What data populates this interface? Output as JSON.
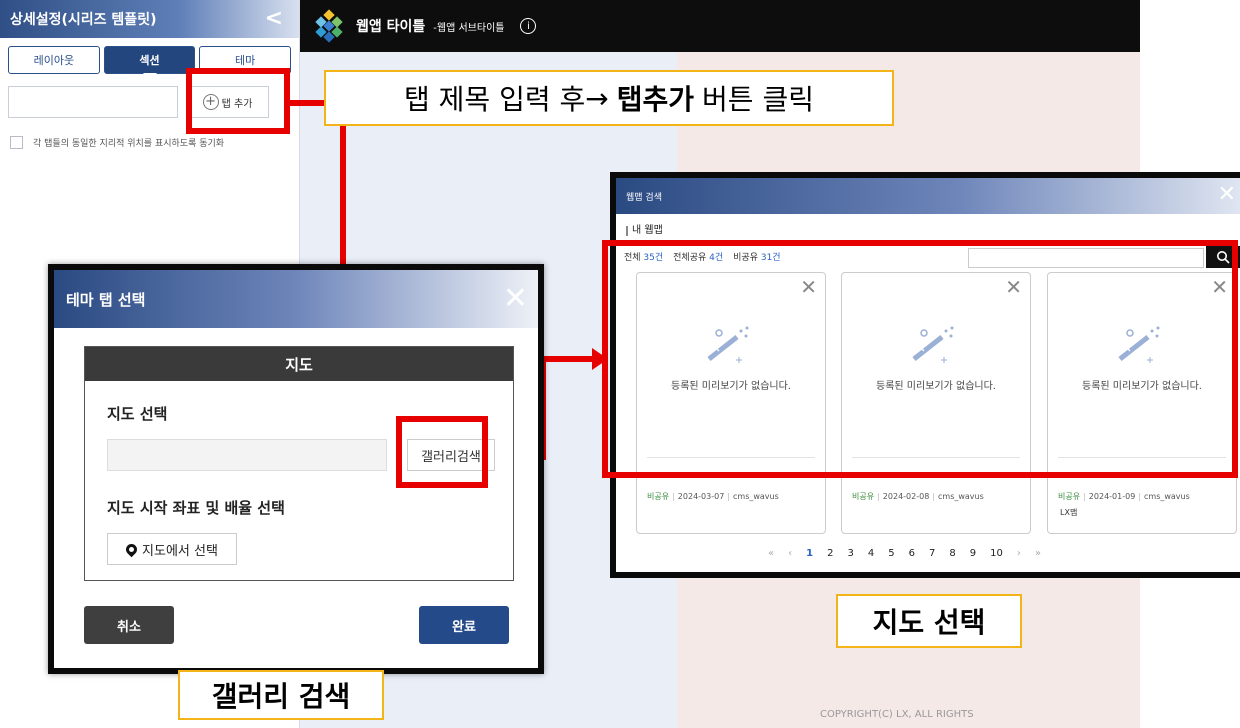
{
  "left_panel": {
    "title": "상세설정(시리즈 템플릿)",
    "collapse_icon": "<",
    "tabs": [
      {
        "label": "레이아웃"
      },
      {
        "label": "섹션"
      },
      {
        "label": "테마"
      }
    ],
    "add_tab_label": "탭 추가",
    "sync_label": "각 탭들의 동일한 지리적 위치를 표시하도록 동기화"
  },
  "header": {
    "app_title": "웹앱 타이틀",
    "app_subtitle": "-웹앱 서브타이틀",
    "info_icon": "i"
  },
  "callouts": {
    "top": {
      "pre": "탭 제목 입력 후 ",
      "arrow": "→",
      "bold": "탭추가",
      "post": "버튼 클릭"
    },
    "map_select": "지도 선택",
    "gallery_search": "갤러리 검색"
  },
  "theme_dialog": {
    "title": "테마 탭 선택",
    "section_title": "지도",
    "map_select_label": "지도 선택",
    "gallery_search_button": "갤러리검색",
    "coord_label": "지도 시작 좌표 및 배율 선택",
    "select_on_map_button": "지도에서 선택",
    "cancel": "취소",
    "done": "완료"
  },
  "webmap_dialog": {
    "title": "웹맵 검색",
    "section": "내 웹맵",
    "counts": [
      {
        "label": "전체 ",
        "value": "35건"
      },
      {
        "label": "전체공유 ",
        "value": "4건"
      },
      {
        "label": "비공유 ",
        "value": "31건"
      }
    ],
    "cards": [
      {
        "no_preview": "등록된 미리보기가 없습니다.",
        "share": "비공유",
        "date": "2024-03-07",
        "owner": "cms_wavus",
        "name": ""
      },
      {
        "no_preview": "등록된 미리보기가 없습니다.",
        "share": "비공유",
        "date": "2024-02-08",
        "owner": "cms_wavus",
        "name": ""
      },
      {
        "no_preview": "등록된 미리보기가 없습니다.",
        "share": "비공유",
        "date": "2024-01-09",
        "owner": "cms_wavus",
        "name": "LX맵"
      }
    ],
    "pagination": {
      "first": "«",
      "prev": "‹",
      "pages": [
        "1",
        "2",
        "3",
        "4",
        "5",
        "6",
        "7",
        "8",
        "9",
        "10"
      ],
      "next": "›",
      "last": "»",
      "current": "1"
    }
  },
  "footer": {
    "copyright": "COPYRIGHT(C) LX, ALL RIGHTS"
  },
  "colors": {
    "highlight_red": "#e60000",
    "callout_border": "#f2b417",
    "primary_navy": "#244a8a"
  }
}
